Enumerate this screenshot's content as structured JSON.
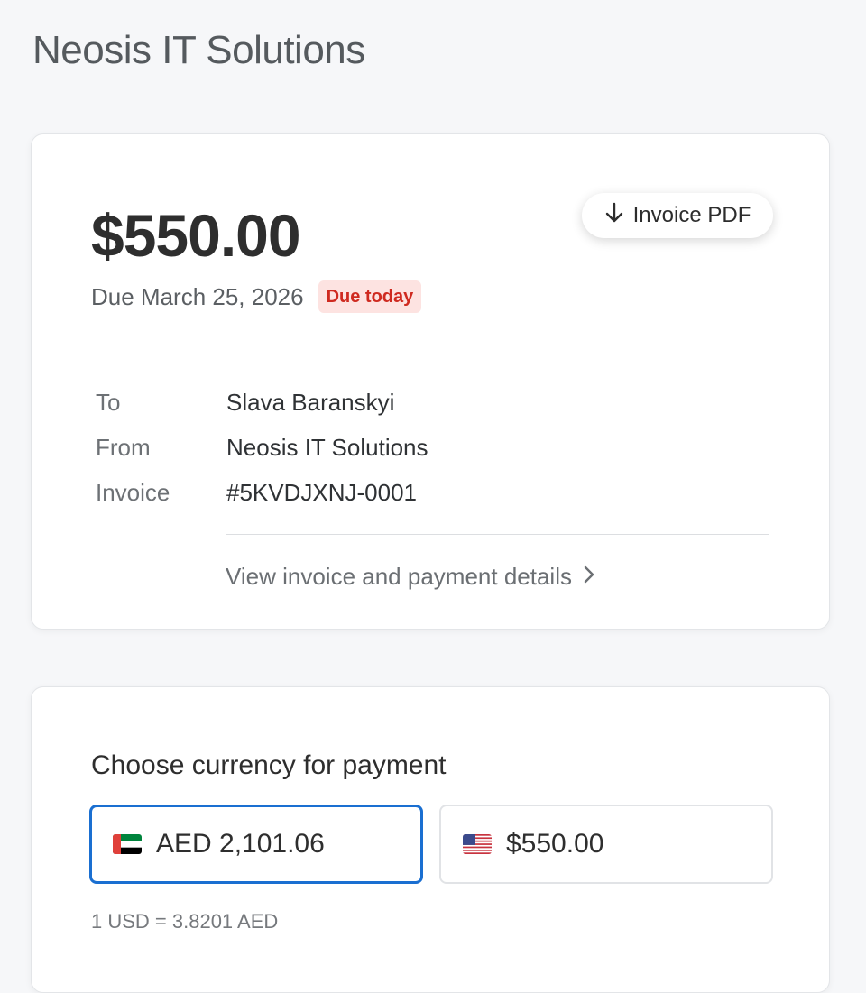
{
  "merchant": {
    "name": "Neosis IT Solutions"
  },
  "invoice": {
    "amount": "$550.00",
    "pdf_button_label": "Invoice PDF",
    "due_date_text": "Due March 25, 2026",
    "due_badge": "Due today",
    "details": [
      {
        "label": "To",
        "value": "Slava Baranskyi"
      },
      {
        "label": "From",
        "value": "Neosis IT Solutions"
      },
      {
        "label": "Invoice",
        "value": "#5KVDJXNJ-0001"
      }
    ],
    "view_details_link": "View invoice and payment details"
  },
  "currency": {
    "heading": "Choose currency for payment",
    "options": [
      {
        "flag": "uae-flag-icon",
        "amount": "AED 2,101.06",
        "selected": true
      },
      {
        "flag": "us-flag-icon",
        "amount": "$550.00",
        "selected": false
      }
    ],
    "rate_text": "1 USD = 3.8201 AED"
  },
  "colors": {
    "accent": "#1a6fd1",
    "badge_background": "#fde3e1",
    "badge_text": "#cf2a20",
    "page_background": "#f6f7f9"
  }
}
